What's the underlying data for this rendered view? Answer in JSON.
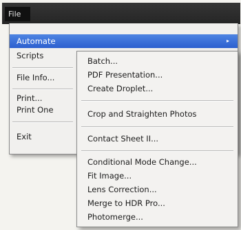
{
  "menubar": {
    "file_label": "File"
  },
  "file_menu": {
    "items": [
      {
        "label": "Automate",
        "highlighted": true,
        "submenu_arrow": "▸"
      },
      {
        "label": "Scripts"
      },
      {
        "label": "File Info..."
      },
      {
        "label": "Print..."
      },
      {
        "label": "Print One"
      },
      {
        "label": "Exit"
      }
    ]
  },
  "automate_submenu": {
    "items": [
      {
        "label": "Batch..."
      },
      {
        "label": "PDF Presentation..."
      },
      {
        "label": "Create Droplet..."
      },
      {
        "label": "Crop and Straighten Photos"
      },
      {
        "label": "Contact Sheet II..."
      },
      {
        "label": "Conditional Mode Change..."
      },
      {
        "label": "Fit Image..."
      },
      {
        "label": "Lens Correction..."
      },
      {
        "label": "Merge to HDR Pro..."
      },
      {
        "label": "Photomerge..."
      }
    ]
  },
  "colors": {
    "menubar_bg": "#2e2e2e",
    "highlight": "#3a6fd8",
    "menu_bg": "#f1f0ee"
  }
}
